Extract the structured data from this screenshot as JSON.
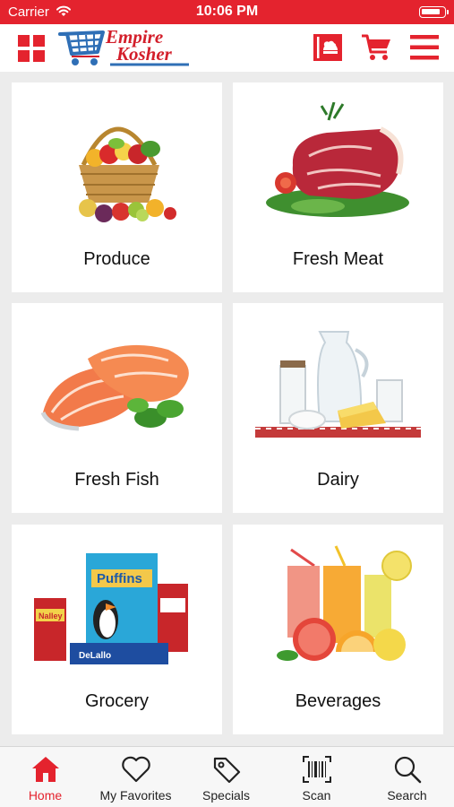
{
  "status_bar": {
    "carrier": "Carrier",
    "time": "10:06 PM"
  },
  "header": {
    "logo_line1": "Empire",
    "logo_line2": "Kosher",
    "icons": [
      "grid-menu-icon",
      "weekly-circular-icon",
      "cart-icon",
      "hamburger-menu-icon"
    ]
  },
  "categories": [
    {
      "label": "Produce",
      "icon": "produce-basket-image"
    },
    {
      "label": "Fresh Meat",
      "icon": "steak-image"
    },
    {
      "label": "Fresh Fish",
      "icon": "salmon-image"
    },
    {
      "label": "Dairy",
      "icon": "dairy-image"
    },
    {
      "label": "Grocery",
      "icon": "grocery-products-image"
    },
    {
      "label": "Beverages",
      "icon": "juice-glasses-image"
    }
  ],
  "product_text": {
    "puffins": "Puffins",
    "nalleys": "Nalley",
    "delallo": "DeLallo"
  },
  "tabs": [
    {
      "label": "Home",
      "icon": "home-icon",
      "active": true
    },
    {
      "label": "My Favorites",
      "icon": "heart-icon",
      "active": false
    },
    {
      "label": "Specials",
      "icon": "tag-icon",
      "active": false
    },
    {
      "label": "Scan",
      "icon": "barcode-icon",
      "active": false
    },
    {
      "label": "Search",
      "icon": "search-icon",
      "active": false
    }
  ],
  "colors": {
    "brand_red": "#e4232e",
    "logo_blue": "#2f6fb6",
    "background": "#ececec"
  }
}
